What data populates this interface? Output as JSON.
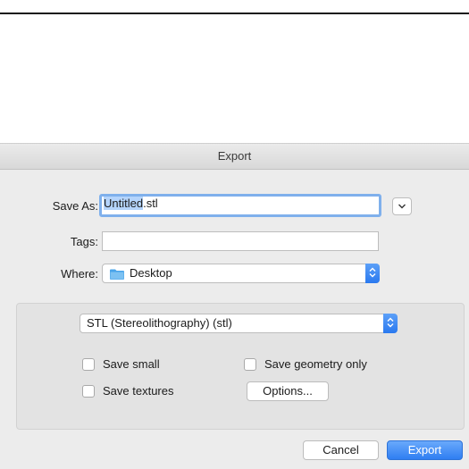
{
  "dialog": {
    "title": "Export"
  },
  "form": {
    "save_as_label": "Save As:",
    "file_name_base": "Untitled",
    "file_extension": ".stl",
    "tags_label": "Tags:",
    "tags_value": "",
    "where_label": "Where:",
    "where_value": "Desktop"
  },
  "options": {
    "format_value": "STL (Stereolithography) (stl)",
    "save_small_label": "Save small",
    "save_small_checked": false,
    "save_geometry_only_label": "Save geometry only",
    "save_geometry_only_checked": false,
    "save_textures_label": "Save textures",
    "save_textures_checked": false,
    "options_button_label": "Options..."
  },
  "buttons": {
    "cancel_label": "Cancel",
    "export_label": "Export"
  },
  "icons": {
    "expand": "chevron-down-icon",
    "location": "folder-icon",
    "popup": "updown-arrows-icon"
  },
  "colors": {
    "accent": "#2f7ef2",
    "selection": "#b4d4fc",
    "folder": "#49a4ea"
  }
}
